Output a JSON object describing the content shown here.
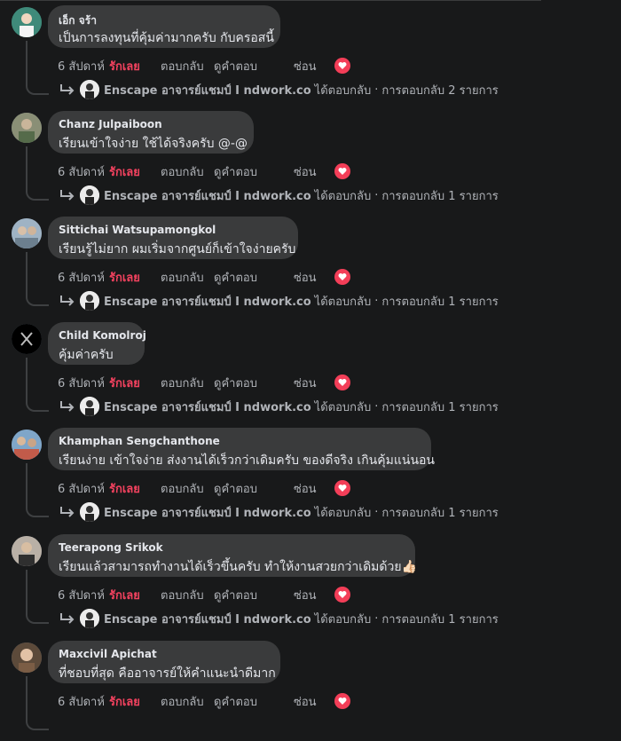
{
  "actions": {
    "time": "6 สัปดาห์",
    "like": "รักเลย",
    "reply": "ตอบกลับ",
    "see_translation": "ดูคำตอบ",
    "hide": "ซ่อน"
  },
  "reply_summary": {
    "author": "Enscape อาจารย์แชมป์ I ndwork.co",
    "verb": "ได้ตอบกลับ",
    "separator": "·",
    "count_template": "การตอบกลับ {n} รายการ"
  },
  "comments": [
    {
      "author": "เอ็ก จร้า",
      "text": "เป็นการลงทุนที่คุ้มค่ามากครับ กับครอสนี้",
      "reply_count_text": "การตอบกลับ 2 รายการ",
      "reply_count": 2
    },
    {
      "author": "Chanz Julpaiboon",
      "text": "เรียนเข้าใจง่าย ใช้ได้จริงครับ @-@",
      "reply_count_text": "การตอบกลับ 1 รายการ",
      "reply_count": 1
    },
    {
      "author": "Sittichai Watsupamongkol",
      "text": "เรียนรู้ไม่ยาก ผมเริ่มจากศูนย์ก็เข้าใจง่ายครับ",
      "reply_count_text": "การตอบกลับ 1 รายการ",
      "reply_count": 1
    },
    {
      "author": "Child Komolroj",
      "text": "คุ้มค่าครับ",
      "reply_count_text": "การตอบกลับ 1 รายการ",
      "reply_count": 1
    },
    {
      "author": "Khamphan Sengchanthone",
      "text": "เรียนง่าย เข้าใจง่าย ส่งงานได้เร็วกว่าเดิมครับ ของดีจริง เกินคุ้มแน่นอน",
      "reply_count_text": "การตอบกลับ 1 รายการ",
      "reply_count": 1
    },
    {
      "author": "Teerapong Srikok",
      "text": "เรียนแล้วสามารถทำงานได้เร็วขึ้นครับ ทำให้งานสวยกว่าเดิมด้วย👍🏻",
      "reply_count_text": "การตอบกลับ 1 รายการ",
      "reply_count": 1
    },
    {
      "author": "Maxcivil Apichat",
      "text": "ที่ชอบที่สุด คืออาจารย์ให้คำแนะนำดีมาก",
      "reply_count_text": "",
      "reply_count": null
    }
  ],
  "colors": {
    "background": "#18191a",
    "bubble": "#3a3b3c",
    "like_active": "#f3425f",
    "heart_badge": "#f33e58",
    "secondary_text": "#b0b3b8"
  },
  "icons": {
    "reaction": "heart-icon",
    "reply_arrow": "reply-arrow-icon"
  }
}
